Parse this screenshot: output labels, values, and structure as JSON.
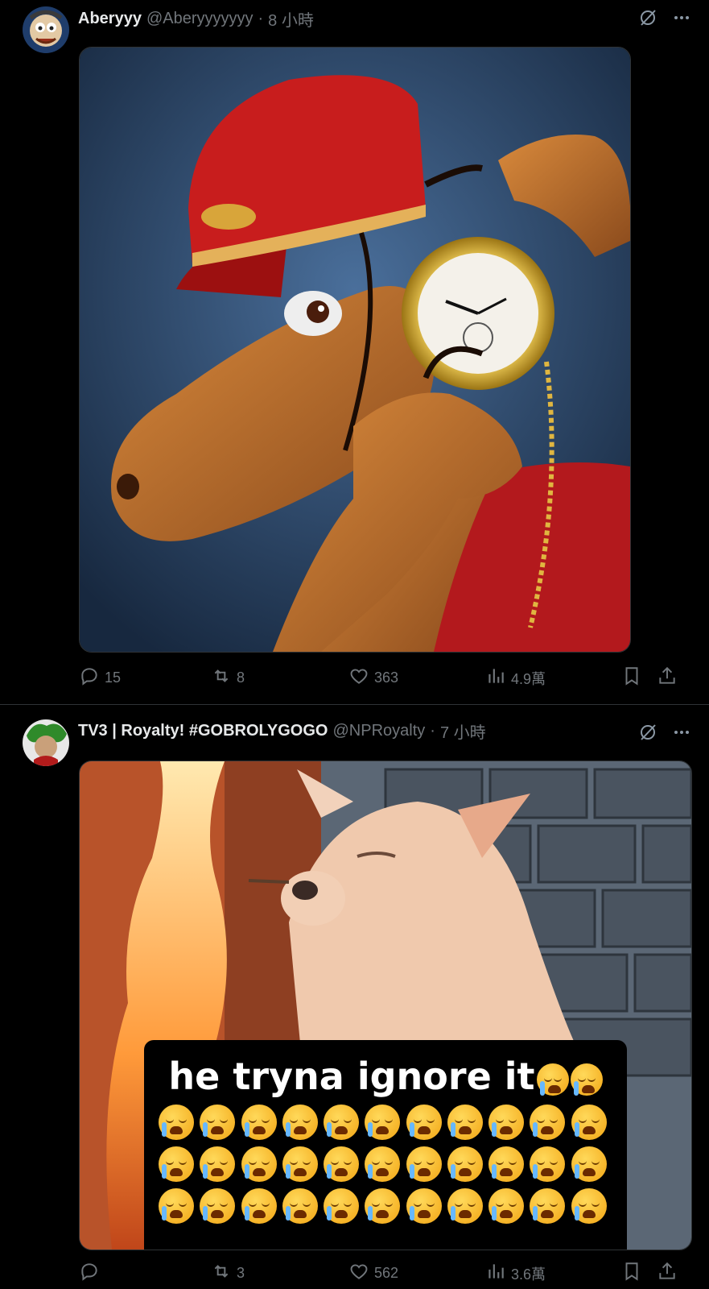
{
  "tweets": [
    {
      "name": "Aberyyy",
      "handle": "@Aberyyyyyyy",
      "dot": "·",
      "time": "8 小時",
      "icons": {
        "grok": "grok-icon",
        "more": "more-icon"
      },
      "media": {
        "icon": "illustration-image"
      },
      "stats": {
        "replies": "15",
        "reposts": "8",
        "likes": "363",
        "views": "4.9萬"
      }
    },
    {
      "name": "TV3 | Royalty! #GOBROLYGOGO",
      "handle": "@NPRoyalty",
      "dot": "·",
      "time": "7 小時",
      "icons": {
        "grok": "grok-icon",
        "more": "more-icon"
      },
      "media": {
        "caption": "he tryna ignore it",
        "emoji": "loudly-crying-face"
      },
      "stats": {
        "replies": "",
        "reposts": "3",
        "likes": "562",
        "views": "3.6萬"
      }
    }
  ],
  "colors": {
    "background": "#000000",
    "text": "#e7e9ea",
    "muted": "#71767b",
    "divider": "#2f3336"
  }
}
